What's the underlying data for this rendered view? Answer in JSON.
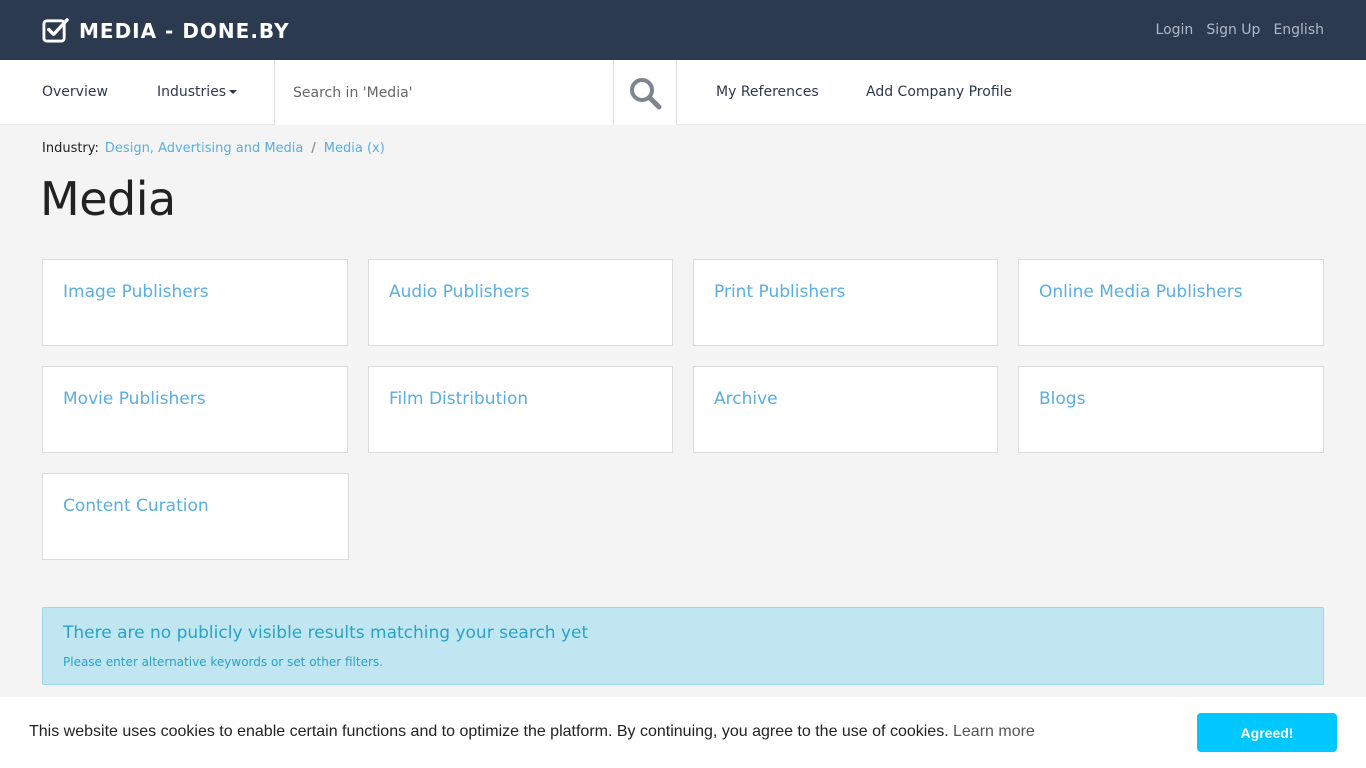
{
  "header": {
    "brand": "MEDIA - DONE.BY",
    "links": {
      "login": "Login",
      "signup": "Sign Up",
      "language": "English"
    }
  },
  "nav": {
    "overview": "Overview",
    "industries": "Industries",
    "search_placeholder": "Search in 'Media'",
    "my_references": "My References",
    "add_company_profile": "Add Company Profile"
  },
  "breadcrumb": {
    "label": "Industry:",
    "parent": "Design, Advertising and Media",
    "separator": "/",
    "current": "Media (x)"
  },
  "page_title": "Media",
  "categories": [
    "Image Publishers",
    "Audio Publishers",
    "Print Publishers",
    "Online Media Publishers",
    "Movie Publishers",
    "Film Distribution",
    "Archive",
    "Blogs",
    "Content Curation"
  ],
  "alert": {
    "title": "There are no publicly visible results matching your search yet",
    "text": "Please enter alternative keywords or set other filters."
  },
  "cookie": {
    "text": "This website uses cookies to enable certain functions and to optimize the platform. By continuing, you agree to the use of cookies.",
    "learn_more": "Learn more",
    "agree": "Agreed!"
  },
  "colors": {
    "topbar": "#2c3a4f",
    "link": "#5aaee0",
    "alert_bg": "#bfe6f1",
    "cookie_button": "#00c8ff"
  }
}
